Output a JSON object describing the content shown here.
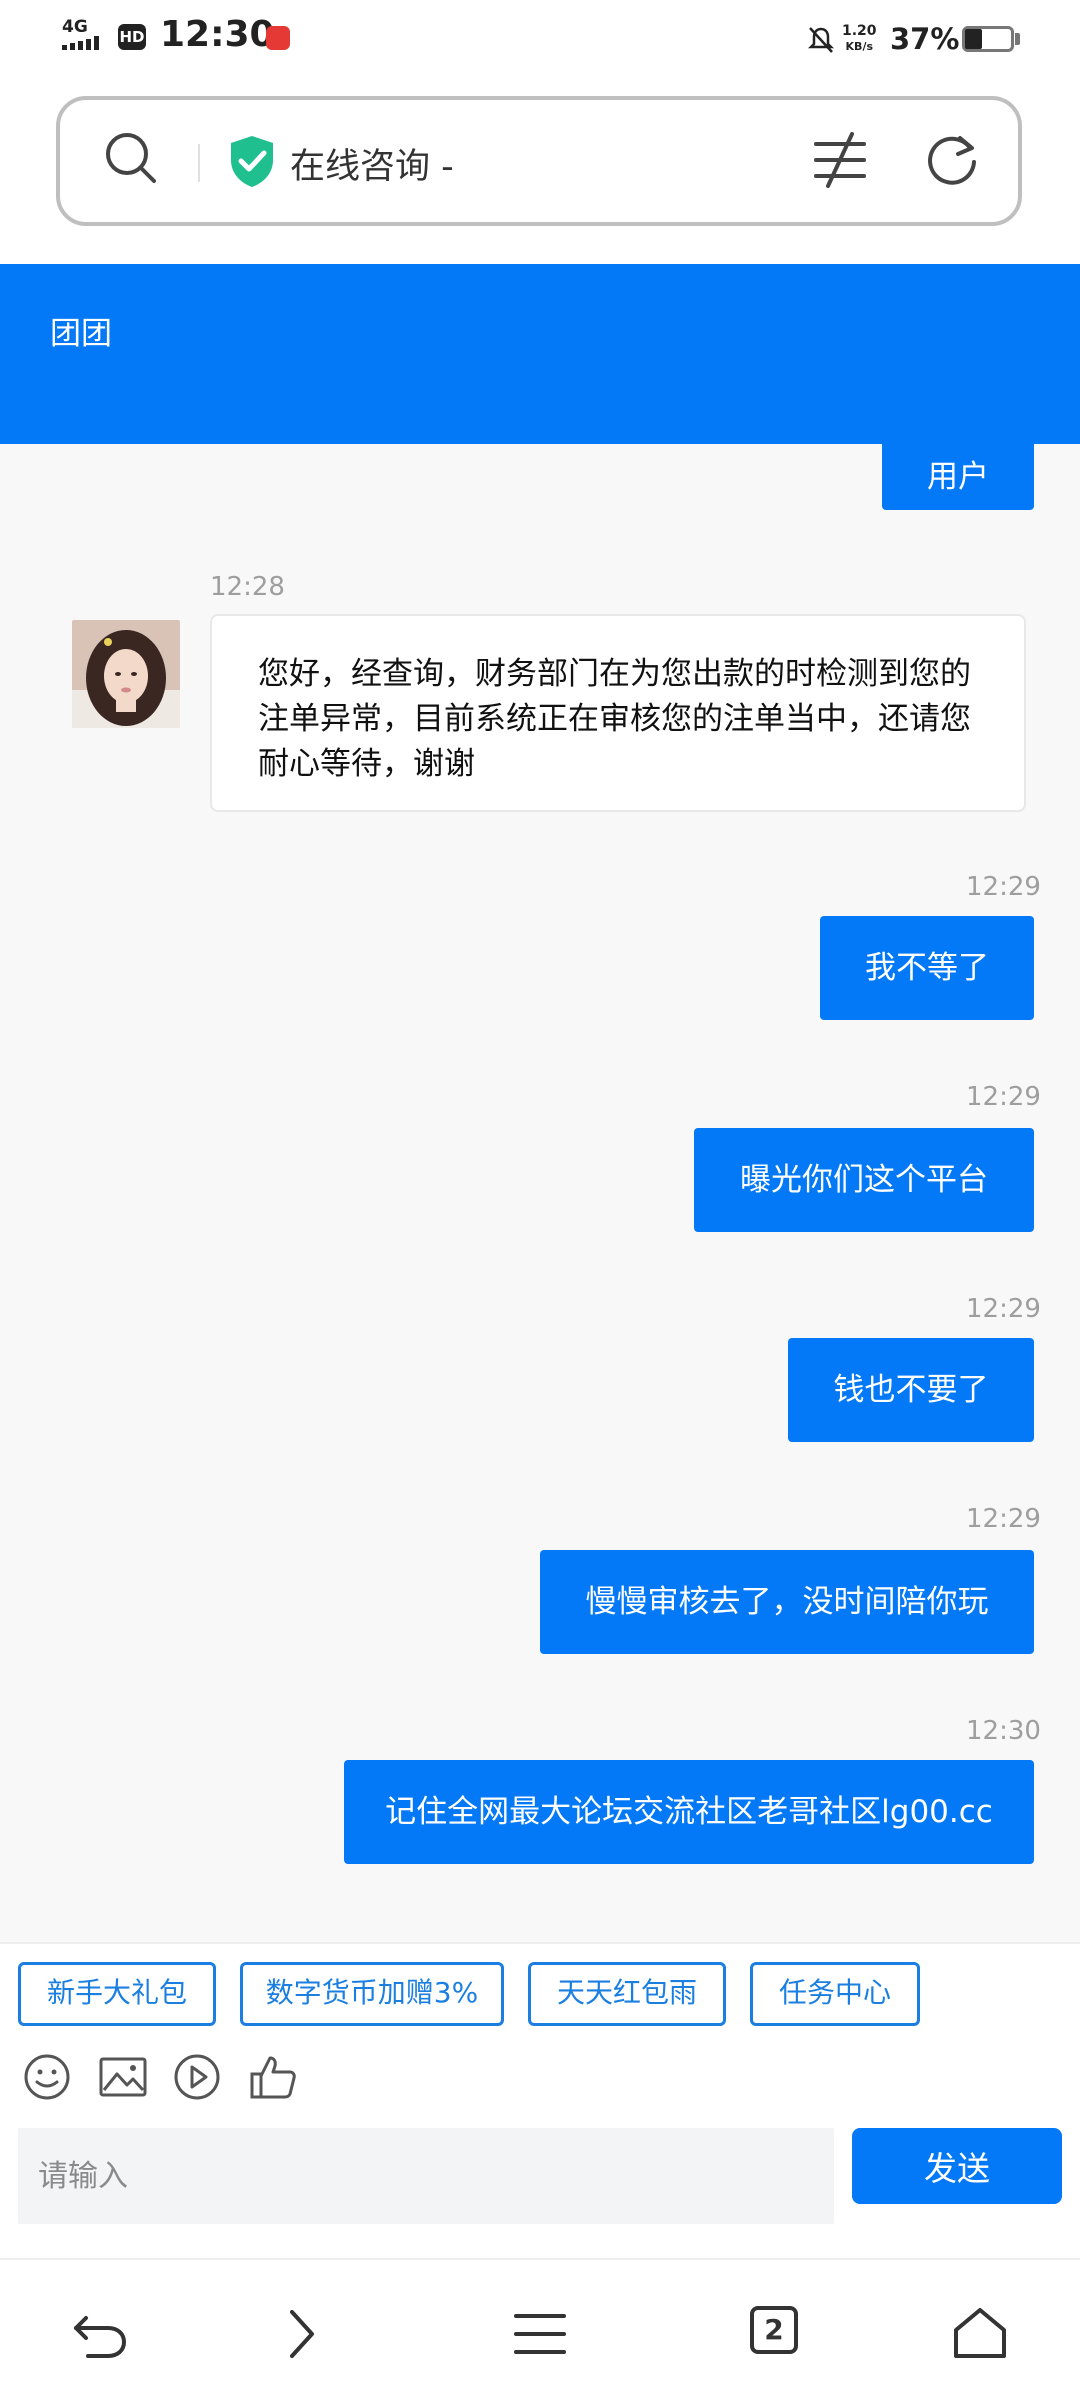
{
  "status_bar": {
    "network": "4G",
    "hd_label": "HD",
    "time": "12:30",
    "speed_value": "1.20",
    "speed_unit": "KB/s",
    "battery": "37%"
  },
  "address_bar": {
    "title": "在线咨询 -"
  },
  "chat": {
    "header_title": "团团",
    "partial_user_label": "用户",
    "messages": [
      {
        "direction": "in",
        "time": "12:28",
        "text": "您好，经查询，财务部门在为您出款的时检测到您的注单异常，目前系统正在审核您的注单当中，还请您耐心等待，谢谢"
      },
      {
        "direction": "out",
        "time": "12:29",
        "text": "我不等了"
      },
      {
        "direction": "out",
        "time": "12:29",
        "text": "曝光你们这个平台"
      },
      {
        "direction": "out",
        "time": "12:29",
        "text": "钱也不要了"
      },
      {
        "direction": "out",
        "time": "12:29",
        "text": "慢慢审核去了，没时间陪你玩"
      },
      {
        "direction": "out",
        "time": "12:30",
        "text": "记住全网最大论坛交流社区老哥社区lg00.cc"
      }
    ]
  },
  "quick_actions": [
    "新手大礼包",
    "数字货币加赠3%",
    "天天红包雨",
    "任务中心"
  ],
  "composer": {
    "placeholder": "请输入",
    "value": "",
    "send_label": "发送"
  },
  "nav": {
    "tab_count": "2"
  },
  "colors": {
    "accent": "#0479f7",
    "chat_bg": "#f8f8f8",
    "quick_border": "#1a7fe0"
  },
  "icons": [
    "search-icon",
    "shield-check-icon",
    "filter-icon",
    "reload-icon",
    "emoji-icon",
    "image-icon",
    "video-icon",
    "thumbs-up-icon",
    "back-icon",
    "forward-icon",
    "menu-icon",
    "tabs-icon",
    "home-icon"
  ]
}
